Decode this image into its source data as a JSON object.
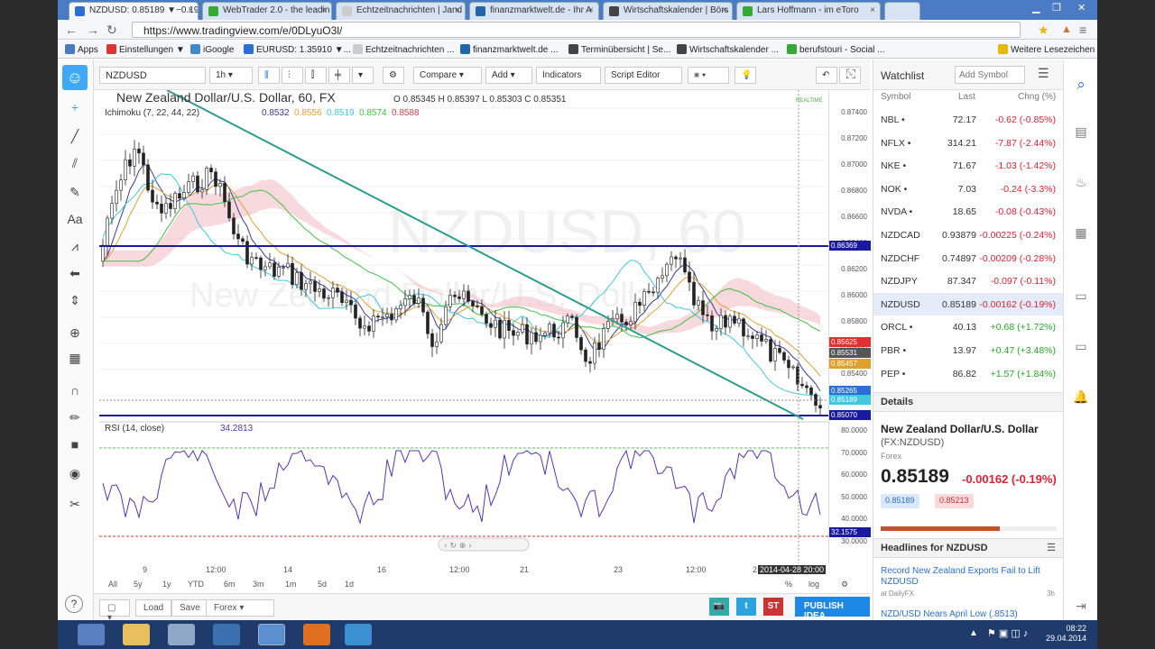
{
  "browser": {
    "tabs": [
      {
        "title": "NZDUSD: 0.85189 ▼−0.19%"
      },
      {
        "title": "WebTrader 2.0 - the leadin"
      },
      {
        "title": "Echtzeitnachrichten | Jand"
      },
      {
        "title": "finanzmarktwelt.de - Ihr A"
      },
      {
        "title": "Wirtschaftskalender | Börs"
      },
      {
        "title": "Lars Hoffmann - im eToro"
      }
    ],
    "url": "https://www.tradingview.com/e/0DLyuO3l/",
    "bookmarks": [
      "Apps",
      "Einstellungen ▼",
      "iGoogle",
      "EURUSD: 1.35910 ▼...",
      "Echtzeitnachrichten ...",
      "finanzmarktwelt.de ...",
      "Terminübersicht | Se...",
      "Wirtschaftskalender ...",
      "berufstouri - Social ...",
      "Weitere Lesezeichen"
    ]
  },
  "toolbar": {
    "symbol": "NZDUSD",
    "interval": "1h",
    "compare": "Compare",
    "add": "Add",
    "indicators": "Indicators",
    "script_editor": "Script Editor"
  },
  "chart": {
    "title": "New Zealand Dollar/U.S. Dollar, 60, FX",
    "ohlc": "O 0.85345 H 0.85397 L 0.85303 C 0.85351",
    "realtime": "REALTIME",
    "watermark_main": "NZDUSD, 60",
    "watermark_sub": "New Zealand Dollar/U.S. Dollar",
    "ichimoku_label": "Ichimoku (7, 22, 44, 22)",
    "ichimoku_values": [
      "0.8532",
      "0.8556",
      "0.8519",
      "0.8574",
      "0.8588"
    ],
    "ichimoku_colors": [
      "#3a3a9e",
      "#e0a030",
      "#40c8e0",
      "#40c040",
      "#d04050"
    ],
    "rsi_label": "RSI (14, close)",
    "rsi_value": "34.2813",
    "price_ticks": [
      "0.87400",
      "0.87200",
      "0.87000",
      "0.86800",
      "0.86600",
      "0.86400",
      "0.86200",
      "0.86000",
      "0.85800",
      "0.85600",
      "0.85400",
      "0.85200"
    ],
    "price_labels": [
      {
        "text": "0.86369",
        "color": "#1a1aa0"
      },
      {
        "text": "0.85625",
        "color": "#e03030"
      },
      {
        "text": "0.85531",
        "color": "#555555"
      },
      {
        "text": "0.85457",
        "color": "#e0a030"
      },
      {
        "text": "0.85265",
        "color": "#2a6fd8"
      },
      {
        "text": "0.85189",
        "color": "#40c8e0"
      },
      {
        "text": "0.85070",
        "color": "#1a1aa0"
      }
    ],
    "rsi_ticks": [
      "80.0000",
      "70.0000",
      "60.0000",
      "50.0000",
      "40.0000",
      "30.0000"
    ],
    "rsi_label_box": "32.1575",
    "time_labels": [
      "9",
      "12:00",
      "14",
      "16",
      "12:00",
      "21",
      "23",
      "12:00",
      "2",
      "2014-04-28 20:00"
    ],
    "ranges": [
      "All",
      "5y",
      "1y",
      "YTD",
      "6m",
      "3m",
      "1m",
      "5d",
      "1d"
    ],
    "axis_opts": [
      "%",
      "log"
    ]
  },
  "footer": {
    "load": "Load",
    "save": "Save",
    "forex": "Forex",
    "publish": "PUBLISH IDEA",
    "st": "ST"
  },
  "watchlist": {
    "title": "Watchlist",
    "add_placeholder": "Add Symbol",
    "col_symbol": "Symbol",
    "col_last": "Last",
    "col_change": "Chng (%)",
    "rows": [
      {
        "sym": "NBL •",
        "last": "72.17",
        "chg": "-0.62 (-0.85%)",
        "dir": "neg"
      },
      {
        "sym": "NFLX •",
        "last": "314.21",
        "chg": "-7.87 (-2.44%)",
        "dir": "neg"
      },
      {
        "sym": "NKE •",
        "last": "71.67",
        "chg": "-1.03 (-1.42%)",
        "dir": "neg"
      },
      {
        "sym": "NOK •",
        "last": "7.03",
        "chg": "-0.24 (-3.3%)",
        "dir": "neg"
      },
      {
        "sym": "NVDA •",
        "last": "18.65",
        "chg": "-0.08 (-0.43%)",
        "dir": "neg"
      },
      {
        "sym": "NZDCAD",
        "last": "0.93879",
        "chg": "-0.00225 (-0.24%)",
        "dir": "neg"
      },
      {
        "sym": "NZDCHF",
        "last": "0.74897",
        "chg": "-0.00209 (-0.28%)",
        "dir": "neg"
      },
      {
        "sym": "NZDJPY",
        "last": "87.347",
        "chg": "-0.097 (-0.11%)",
        "dir": "neg"
      },
      {
        "sym": "NZDUSD",
        "last": "0.85189",
        "chg": "-0.00162 (-0.19%)",
        "dir": "neg"
      },
      {
        "sym": "ORCL •",
        "last": "40.13",
        "chg": "+0.68 (+1.72%)",
        "dir": "pos"
      },
      {
        "sym": "PBR •",
        "last": "13.97",
        "chg": "+0.47 (+3.48%)",
        "dir": "pos"
      },
      {
        "sym": "PEP •",
        "last": "86.82",
        "chg": "+1.57 (+1.84%)",
        "dir": "pos"
      }
    ]
  },
  "details": {
    "title": "Details",
    "name": "New Zealand Dollar/U.S. Dollar",
    "ticker": "(FX:NZDUSD)",
    "type": "Forex",
    "price": "0.85189",
    "change": "-0.00162 (-0.19%)",
    "bid": "0.85189",
    "ask": "0.85213"
  },
  "headlines": {
    "title": "Headlines for NZDUSD",
    "items": [
      {
        "text": "Record New Zealand Exports Fail to Lift NZDUSD",
        "source": "at DailyFX",
        "age": "3h"
      },
      {
        "text": "NZD/USD Nears April Low (.8513)"
      }
    ]
  },
  "taskbar": {
    "time": "08:22",
    "date": "29.04.2014"
  }
}
